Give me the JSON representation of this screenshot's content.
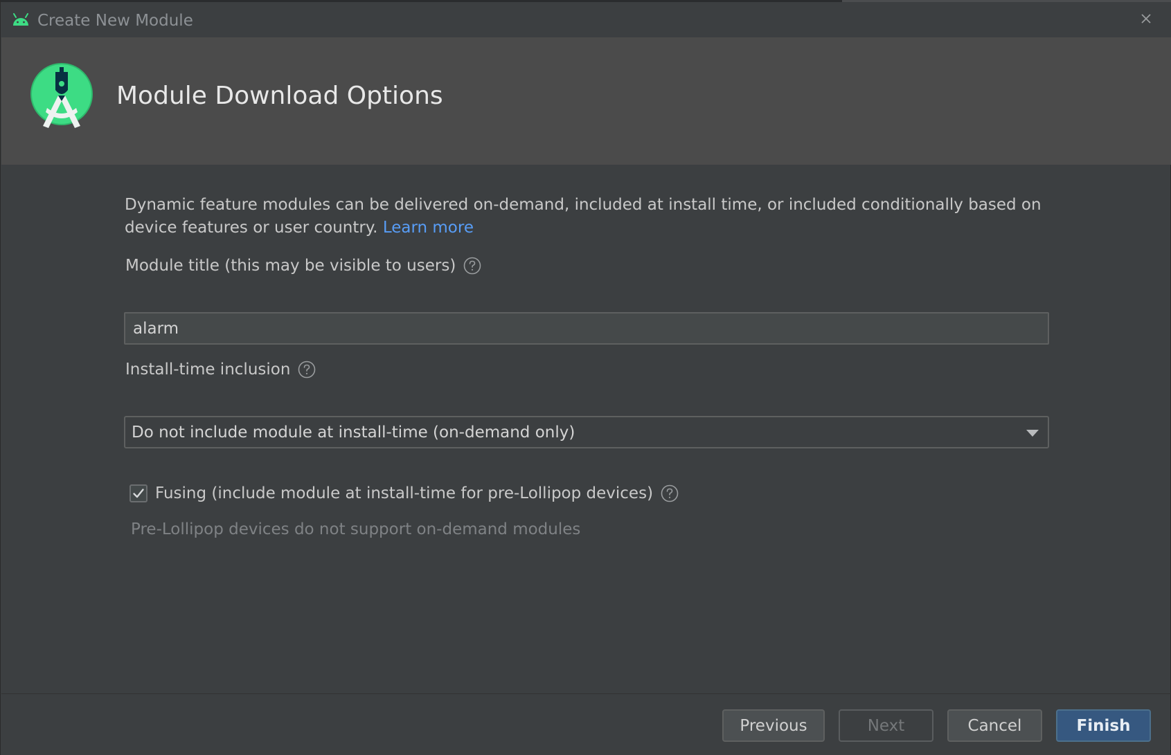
{
  "window": {
    "title": "Create New Module",
    "close_icon": "close-icon"
  },
  "header": {
    "title": "Module Download Options",
    "logo_icon": "android-studio-logo"
  },
  "content": {
    "description": "Dynamic feature modules can be delivered on-demand, included at install time, or included conditionally based on device features or user country.",
    "learn_more": "Learn more",
    "module_title": {
      "label": "Module title (this may be visible to users)",
      "value": "alarm"
    },
    "install_time": {
      "label": "Install-time inclusion",
      "selected": "Do not include module at install-time (on-demand only)"
    },
    "fusing": {
      "label": "Fusing (include module at install-time for pre-Lollipop devices)",
      "checked": true
    },
    "hint": "Pre-Lollipop devices do not support on-demand modules"
  },
  "footer": {
    "previous": "Previous",
    "next": "Next",
    "cancel": "Cancel",
    "finish": "Finish"
  },
  "colors": {
    "background": "#3c3f41",
    "header": "#4b4b4b",
    "accent": "#365880",
    "link": "#589df6",
    "android_green": "#3ddc84"
  }
}
